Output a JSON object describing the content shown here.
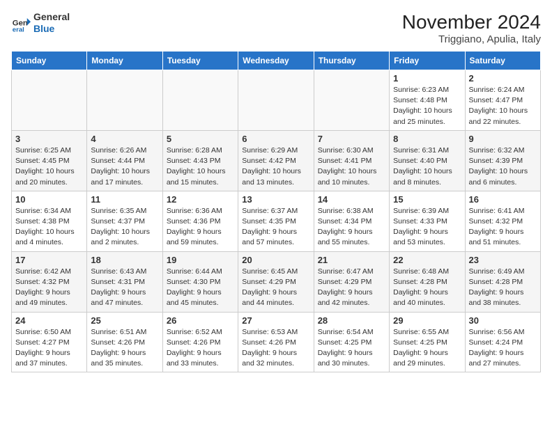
{
  "logo": {
    "line1": "General",
    "line2": "Blue"
  },
  "title": "November 2024",
  "subtitle": "Triggiano, Apulia, Italy",
  "days_of_week": [
    "Sunday",
    "Monday",
    "Tuesday",
    "Wednesday",
    "Thursday",
    "Friday",
    "Saturday"
  ],
  "weeks": [
    [
      {
        "day": "",
        "info": ""
      },
      {
        "day": "",
        "info": ""
      },
      {
        "day": "",
        "info": ""
      },
      {
        "day": "",
        "info": ""
      },
      {
        "day": "",
        "info": ""
      },
      {
        "day": "1",
        "info": "Sunrise: 6:23 AM\nSunset: 4:48 PM\nDaylight: 10 hours and 25 minutes."
      },
      {
        "day": "2",
        "info": "Sunrise: 6:24 AM\nSunset: 4:47 PM\nDaylight: 10 hours and 22 minutes."
      }
    ],
    [
      {
        "day": "3",
        "info": "Sunrise: 6:25 AM\nSunset: 4:45 PM\nDaylight: 10 hours and 20 minutes."
      },
      {
        "day": "4",
        "info": "Sunrise: 6:26 AM\nSunset: 4:44 PM\nDaylight: 10 hours and 17 minutes."
      },
      {
        "day": "5",
        "info": "Sunrise: 6:28 AM\nSunset: 4:43 PM\nDaylight: 10 hours and 15 minutes."
      },
      {
        "day": "6",
        "info": "Sunrise: 6:29 AM\nSunset: 4:42 PM\nDaylight: 10 hours and 13 minutes."
      },
      {
        "day": "7",
        "info": "Sunrise: 6:30 AM\nSunset: 4:41 PM\nDaylight: 10 hours and 10 minutes."
      },
      {
        "day": "8",
        "info": "Sunrise: 6:31 AM\nSunset: 4:40 PM\nDaylight: 10 hours and 8 minutes."
      },
      {
        "day": "9",
        "info": "Sunrise: 6:32 AM\nSunset: 4:39 PM\nDaylight: 10 hours and 6 minutes."
      }
    ],
    [
      {
        "day": "10",
        "info": "Sunrise: 6:34 AM\nSunset: 4:38 PM\nDaylight: 10 hours and 4 minutes."
      },
      {
        "day": "11",
        "info": "Sunrise: 6:35 AM\nSunset: 4:37 PM\nDaylight: 10 hours and 2 minutes."
      },
      {
        "day": "12",
        "info": "Sunrise: 6:36 AM\nSunset: 4:36 PM\nDaylight: 9 hours and 59 minutes."
      },
      {
        "day": "13",
        "info": "Sunrise: 6:37 AM\nSunset: 4:35 PM\nDaylight: 9 hours and 57 minutes."
      },
      {
        "day": "14",
        "info": "Sunrise: 6:38 AM\nSunset: 4:34 PM\nDaylight: 9 hours and 55 minutes."
      },
      {
        "day": "15",
        "info": "Sunrise: 6:39 AM\nSunset: 4:33 PM\nDaylight: 9 hours and 53 minutes."
      },
      {
        "day": "16",
        "info": "Sunrise: 6:41 AM\nSunset: 4:32 PM\nDaylight: 9 hours and 51 minutes."
      }
    ],
    [
      {
        "day": "17",
        "info": "Sunrise: 6:42 AM\nSunset: 4:32 PM\nDaylight: 9 hours and 49 minutes."
      },
      {
        "day": "18",
        "info": "Sunrise: 6:43 AM\nSunset: 4:31 PM\nDaylight: 9 hours and 47 minutes."
      },
      {
        "day": "19",
        "info": "Sunrise: 6:44 AM\nSunset: 4:30 PM\nDaylight: 9 hours and 45 minutes."
      },
      {
        "day": "20",
        "info": "Sunrise: 6:45 AM\nSunset: 4:29 PM\nDaylight: 9 hours and 44 minutes."
      },
      {
        "day": "21",
        "info": "Sunrise: 6:47 AM\nSunset: 4:29 PM\nDaylight: 9 hours and 42 minutes."
      },
      {
        "day": "22",
        "info": "Sunrise: 6:48 AM\nSunset: 4:28 PM\nDaylight: 9 hours and 40 minutes."
      },
      {
        "day": "23",
        "info": "Sunrise: 6:49 AM\nSunset: 4:28 PM\nDaylight: 9 hours and 38 minutes."
      }
    ],
    [
      {
        "day": "24",
        "info": "Sunrise: 6:50 AM\nSunset: 4:27 PM\nDaylight: 9 hours and 37 minutes."
      },
      {
        "day": "25",
        "info": "Sunrise: 6:51 AM\nSunset: 4:26 PM\nDaylight: 9 hours and 35 minutes."
      },
      {
        "day": "26",
        "info": "Sunrise: 6:52 AM\nSunset: 4:26 PM\nDaylight: 9 hours and 33 minutes."
      },
      {
        "day": "27",
        "info": "Sunrise: 6:53 AM\nSunset: 4:26 PM\nDaylight: 9 hours and 32 minutes."
      },
      {
        "day": "28",
        "info": "Sunrise: 6:54 AM\nSunset: 4:25 PM\nDaylight: 9 hours and 30 minutes."
      },
      {
        "day": "29",
        "info": "Sunrise: 6:55 AM\nSunset: 4:25 PM\nDaylight: 9 hours and 29 minutes."
      },
      {
        "day": "30",
        "info": "Sunrise: 6:56 AM\nSunset: 4:24 PM\nDaylight: 9 hours and 27 minutes."
      }
    ]
  ]
}
